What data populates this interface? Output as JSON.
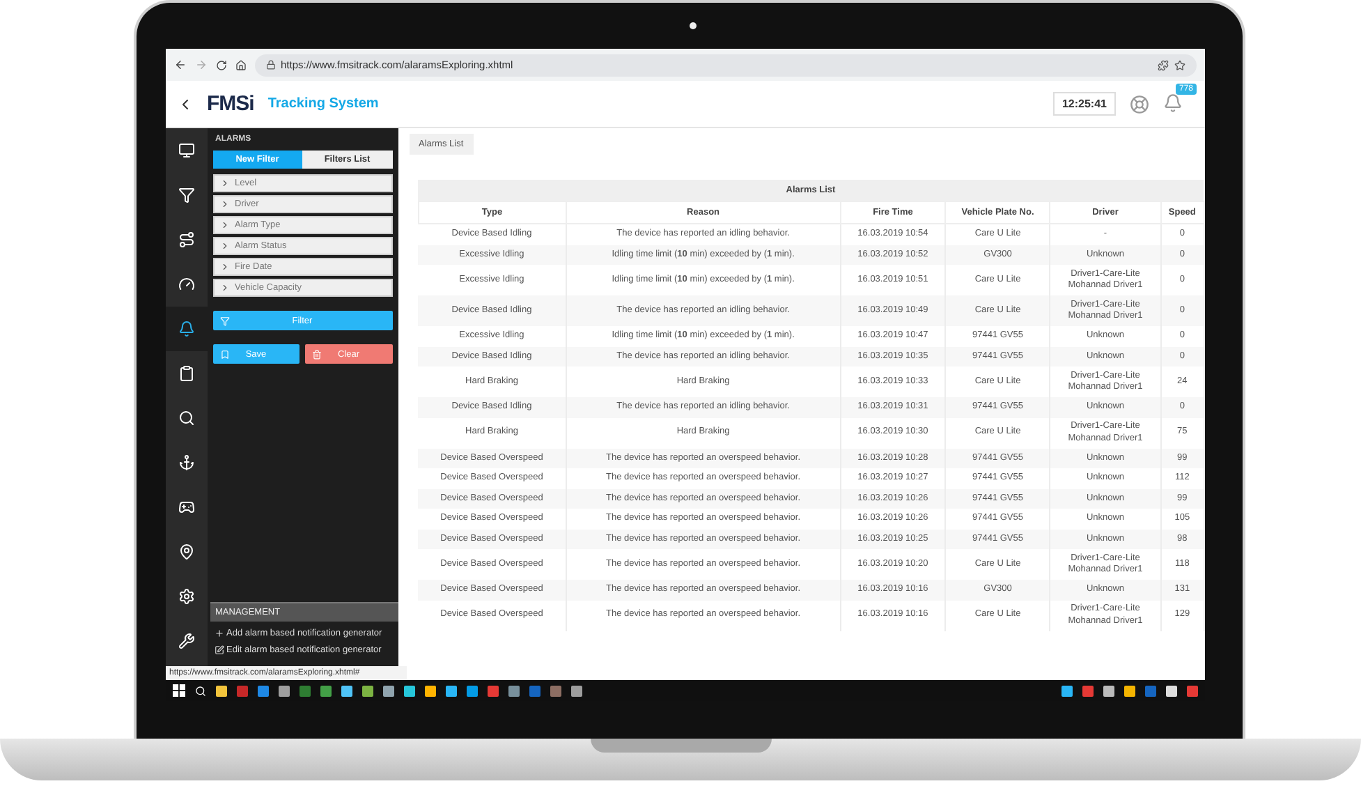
{
  "browser": {
    "url": "https://www.fmsitrack.com/alaramsExploring.xhtml",
    "status_url": "https://www.fmsitrack.com/alaramsExploring.xhtml#"
  },
  "header": {
    "logo": "FMSi",
    "title": "Tracking System",
    "clock": "12:25:41",
    "notification_count": "778"
  },
  "rail": [
    {
      "selected": false
    },
    {
      "selected": false
    },
    {
      "selected": false
    },
    {
      "selected": false
    },
    {
      "selected": true
    },
    {
      "selected": false
    },
    {
      "selected": false
    },
    {
      "selected": false
    },
    {
      "selected": false
    },
    {
      "selected": false
    },
    {
      "selected": false
    },
    {
      "selected": false
    }
  ],
  "panel": {
    "title": "ALARMS",
    "tabs": [
      {
        "label": "New Filter",
        "selected": true
      },
      {
        "label": "Filters List",
        "selected": false
      }
    ],
    "filters": [
      "Level",
      "Driver",
      "Alarm Type",
      "Alarm Status",
      "Fire Date",
      "Vehicle Capacity"
    ],
    "filter_button": "Filter",
    "save_button": "Save",
    "clear_button": "Clear"
  },
  "management": {
    "tooltip": "MANAGEMENT",
    "items": [
      "Add alarm based notification generator",
      "Edit alarm based notification generator"
    ]
  },
  "main": {
    "tab": "Alarms List",
    "table": {
      "title": "Alarms List",
      "columns": [
        "Type",
        "Reason",
        "Fire Time",
        "Vehicle Plate No.",
        "Driver",
        "Speed"
      ],
      "rows": [
        [
          "Device Based Idling",
          "The device has reported an idling behavior.",
          "16.03.2019 10:54",
          "Care U Lite",
          [
            "-"
          ],
          "0"
        ],
        [
          "Excessive Idling",
          "Idling time limit (**10** min) exceeded by (**1** min).",
          "16.03.2019 10:52",
          "GV300",
          [
            "Unknown"
          ],
          "0"
        ],
        [
          "Excessive Idling",
          "Idling time limit (**10** min) exceeded by (**1** min).",
          "16.03.2019 10:51",
          "Care U Lite",
          [
            "Driver1-Care-Lite",
            "Mohannad Driver1"
          ],
          "0"
        ],
        [
          "Device Based Idling",
          "The device has reported an idling behavior.",
          "16.03.2019 10:49",
          "Care U Lite",
          [
            "Driver1-Care-Lite",
            "Mohannad Driver1"
          ],
          "0"
        ],
        [
          "Excessive Idling",
          "Idling time limit (**10** min) exceeded by (**1** min).",
          "16.03.2019 10:47",
          "97441 GV55",
          [
            "Unknown"
          ],
          "0"
        ],
        [
          "Device Based Idling",
          "The device has reported an idling behavior.",
          "16.03.2019 10:35",
          "97441 GV55",
          [
            "Unknown"
          ],
          "0"
        ],
        [
          "Hard Braking",
          "Hard Braking",
          "16.03.2019 10:33",
          "Care U Lite",
          [
            "Driver1-Care-Lite",
            "Mohannad Driver1"
          ],
          "24"
        ],
        [
          "Device Based Idling",
          "The device has reported an idling behavior.",
          "16.03.2019 10:31",
          "97441 GV55",
          [
            "Unknown"
          ],
          "0"
        ],
        [
          "Hard Braking",
          "Hard Braking",
          "16.03.2019 10:30",
          "Care U Lite",
          [
            "Driver1-Care-Lite",
            "Mohannad Driver1"
          ],
          "75"
        ],
        [
          "Device Based Overspeed",
          "The device has reported an overspeed behavior.",
          "16.03.2019 10:28",
          "97441 GV55",
          [
            "Unknown"
          ],
          "99"
        ],
        [
          "Device Based Overspeed",
          "The device has reported an overspeed behavior.",
          "16.03.2019 10:27",
          "97441 GV55",
          [
            "Unknown"
          ],
          "112"
        ],
        [
          "Device Based Overspeed",
          "The device has reported an overspeed behavior.",
          "16.03.2019 10:26",
          "97441 GV55",
          [
            "Unknown"
          ],
          "99"
        ],
        [
          "Device Based Overspeed",
          "The device has reported an overspeed behavior.",
          "16.03.2019 10:26",
          "97441 GV55",
          [
            "Unknown"
          ],
          "105"
        ],
        [
          "Device Based Overspeed",
          "The device has reported an overspeed behavior.",
          "16.03.2019 10:25",
          "97441 GV55",
          [
            "Unknown"
          ],
          "98"
        ],
        [
          "Device Based Overspeed",
          "The device has reported an overspeed behavior.",
          "16.03.2019 10:20",
          "Care U Lite",
          [
            "Driver1-Care-Lite",
            "Mohannad Driver1"
          ],
          "118"
        ],
        [
          "Device Based Overspeed",
          "The device has reported an overspeed behavior.",
          "16.03.2019 10:16",
          "GV300",
          [
            "Unknown"
          ],
          "131"
        ],
        [
          "Device Based Overspeed",
          "The device has reported an overspeed behavior.",
          "16.03.2019 10:16",
          "Care U Lite",
          [
            "Driver1-Care-Lite",
            "Mohannad Driver1"
          ],
          "129"
        ]
      ]
    }
  }
}
